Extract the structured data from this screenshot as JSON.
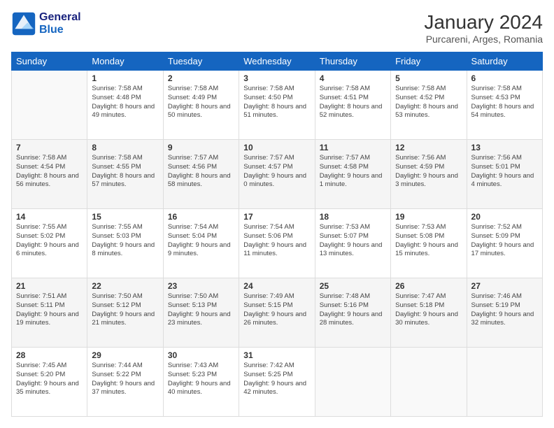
{
  "header": {
    "logo": {
      "line1": "General",
      "line2": "Blue"
    },
    "title": "January 2024",
    "location": "Purcareni, Arges, Romania"
  },
  "weekdays": [
    "Sunday",
    "Monday",
    "Tuesday",
    "Wednesday",
    "Thursday",
    "Friday",
    "Saturday"
  ],
  "weeks": [
    [
      {
        "day": "",
        "sunrise": "",
        "sunset": "",
        "daylight": ""
      },
      {
        "day": "1",
        "sunrise": "7:58 AM",
        "sunset": "4:48 PM",
        "daylight": "8 hours and 49 minutes."
      },
      {
        "day": "2",
        "sunrise": "7:58 AM",
        "sunset": "4:49 PM",
        "daylight": "8 hours and 50 minutes."
      },
      {
        "day": "3",
        "sunrise": "7:58 AM",
        "sunset": "4:50 PM",
        "daylight": "8 hours and 51 minutes."
      },
      {
        "day": "4",
        "sunrise": "7:58 AM",
        "sunset": "4:51 PM",
        "daylight": "8 hours and 52 minutes."
      },
      {
        "day": "5",
        "sunrise": "7:58 AM",
        "sunset": "4:52 PM",
        "daylight": "8 hours and 53 minutes."
      },
      {
        "day": "6",
        "sunrise": "7:58 AM",
        "sunset": "4:53 PM",
        "daylight": "8 hours and 54 minutes."
      }
    ],
    [
      {
        "day": "7",
        "sunrise": "7:58 AM",
        "sunset": "4:54 PM",
        "daylight": "8 hours and 56 minutes."
      },
      {
        "day": "8",
        "sunrise": "7:58 AM",
        "sunset": "4:55 PM",
        "daylight": "8 hours and 57 minutes."
      },
      {
        "day": "9",
        "sunrise": "7:57 AM",
        "sunset": "4:56 PM",
        "daylight": "8 hours and 58 minutes."
      },
      {
        "day": "10",
        "sunrise": "7:57 AM",
        "sunset": "4:57 PM",
        "daylight": "9 hours and 0 minutes."
      },
      {
        "day": "11",
        "sunrise": "7:57 AM",
        "sunset": "4:58 PM",
        "daylight": "9 hours and 1 minute."
      },
      {
        "day": "12",
        "sunrise": "7:56 AM",
        "sunset": "4:59 PM",
        "daylight": "9 hours and 3 minutes."
      },
      {
        "day": "13",
        "sunrise": "7:56 AM",
        "sunset": "5:01 PM",
        "daylight": "9 hours and 4 minutes."
      }
    ],
    [
      {
        "day": "14",
        "sunrise": "7:55 AM",
        "sunset": "5:02 PM",
        "daylight": "9 hours and 6 minutes."
      },
      {
        "day": "15",
        "sunrise": "7:55 AM",
        "sunset": "5:03 PM",
        "daylight": "9 hours and 8 minutes."
      },
      {
        "day": "16",
        "sunrise": "7:54 AM",
        "sunset": "5:04 PM",
        "daylight": "9 hours and 9 minutes."
      },
      {
        "day": "17",
        "sunrise": "7:54 AM",
        "sunset": "5:06 PM",
        "daylight": "9 hours and 11 minutes."
      },
      {
        "day": "18",
        "sunrise": "7:53 AM",
        "sunset": "5:07 PM",
        "daylight": "9 hours and 13 minutes."
      },
      {
        "day": "19",
        "sunrise": "7:53 AM",
        "sunset": "5:08 PM",
        "daylight": "9 hours and 15 minutes."
      },
      {
        "day": "20",
        "sunrise": "7:52 AM",
        "sunset": "5:09 PM",
        "daylight": "9 hours and 17 minutes."
      }
    ],
    [
      {
        "day": "21",
        "sunrise": "7:51 AM",
        "sunset": "5:11 PM",
        "daylight": "9 hours and 19 minutes."
      },
      {
        "day": "22",
        "sunrise": "7:50 AM",
        "sunset": "5:12 PM",
        "daylight": "9 hours and 21 minutes."
      },
      {
        "day": "23",
        "sunrise": "7:50 AM",
        "sunset": "5:13 PM",
        "daylight": "9 hours and 23 minutes."
      },
      {
        "day": "24",
        "sunrise": "7:49 AM",
        "sunset": "5:15 PM",
        "daylight": "9 hours and 26 minutes."
      },
      {
        "day": "25",
        "sunrise": "7:48 AM",
        "sunset": "5:16 PM",
        "daylight": "9 hours and 28 minutes."
      },
      {
        "day": "26",
        "sunrise": "7:47 AM",
        "sunset": "5:18 PM",
        "daylight": "9 hours and 30 minutes."
      },
      {
        "day": "27",
        "sunrise": "7:46 AM",
        "sunset": "5:19 PM",
        "daylight": "9 hours and 32 minutes."
      }
    ],
    [
      {
        "day": "28",
        "sunrise": "7:45 AM",
        "sunset": "5:20 PM",
        "daylight": "9 hours and 35 minutes."
      },
      {
        "day": "29",
        "sunrise": "7:44 AM",
        "sunset": "5:22 PM",
        "daylight": "9 hours and 37 minutes."
      },
      {
        "day": "30",
        "sunrise": "7:43 AM",
        "sunset": "5:23 PM",
        "daylight": "9 hours and 40 minutes."
      },
      {
        "day": "31",
        "sunrise": "7:42 AM",
        "sunset": "5:25 PM",
        "daylight": "9 hours and 42 minutes."
      },
      {
        "day": "",
        "sunrise": "",
        "sunset": "",
        "daylight": ""
      },
      {
        "day": "",
        "sunrise": "",
        "sunset": "",
        "daylight": ""
      },
      {
        "day": "",
        "sunrise": "",
        "sunset": "",
        "daylight": ""
      }
    ]
  ],
  "labels": {
    "sunrise_prefix": "Sunrise: ",
    "sunset_prefix": "Sunset: ",
    "daylight_prefix": "Daylight: "
  }
}
